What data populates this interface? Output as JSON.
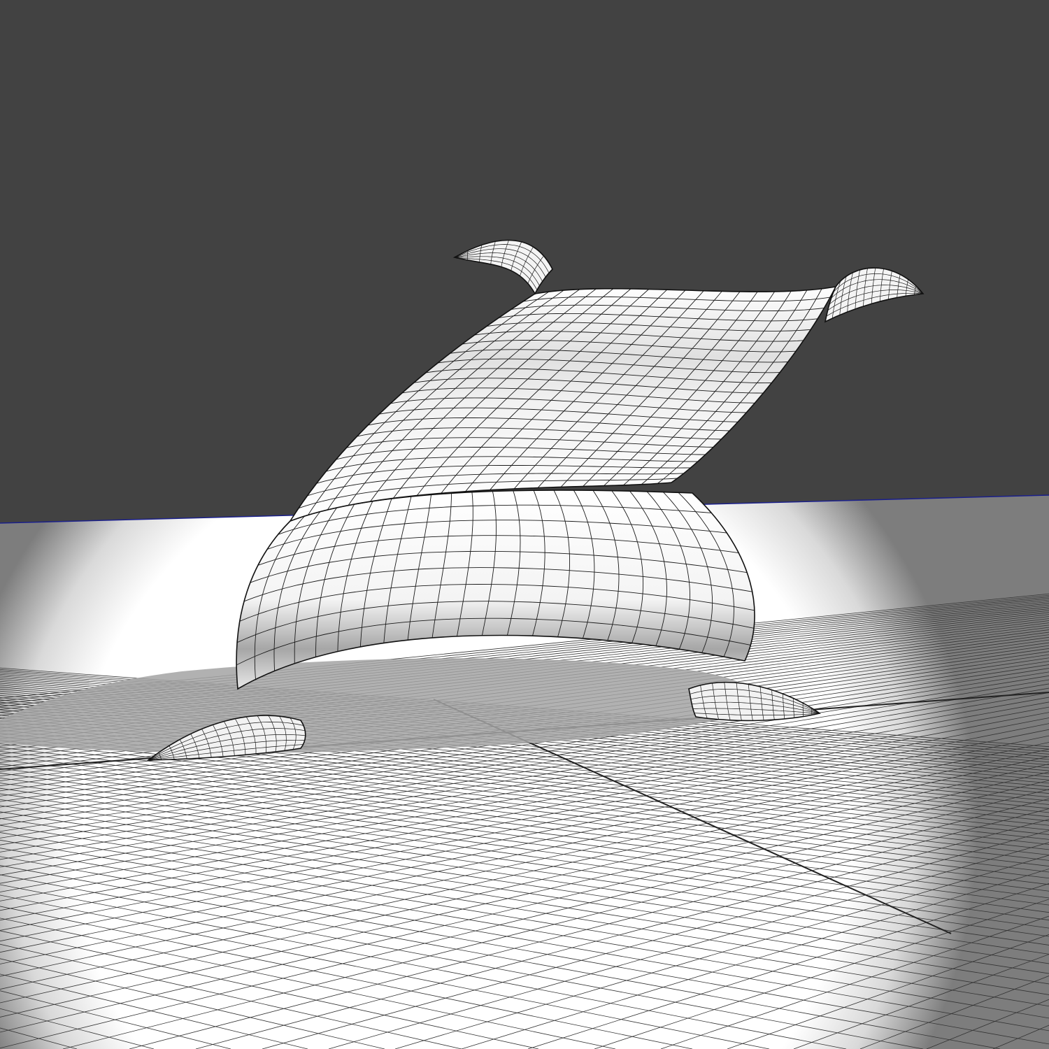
{
  "scene": {
    "colors": {
      "background": "#424242",
      "floor_far": "#7d7d7d",
      "floor_lit": "#ffffff",
      "horizon_line": "#1a1f8a",
      "grid_line": "#333333",
      "axis_line": "#222222",
      "shadow": "#9a9a9a",
      "mesh_fill": "#f2f2f2",
      "mesh_shade": "#8a8a8a",
      "wire": "#1a1a1a"
    },
    "objects": [
      {
        "name": "floor-grid",
        "kind": "ground plane grid"
      },
      {
        "name": "cast-shadow",
        "kind": "shadow"
      },
      {
        "name": "wireframe-mesh",
        "kind": "quad subdivision mesh"
      }
    ]
  }
}
